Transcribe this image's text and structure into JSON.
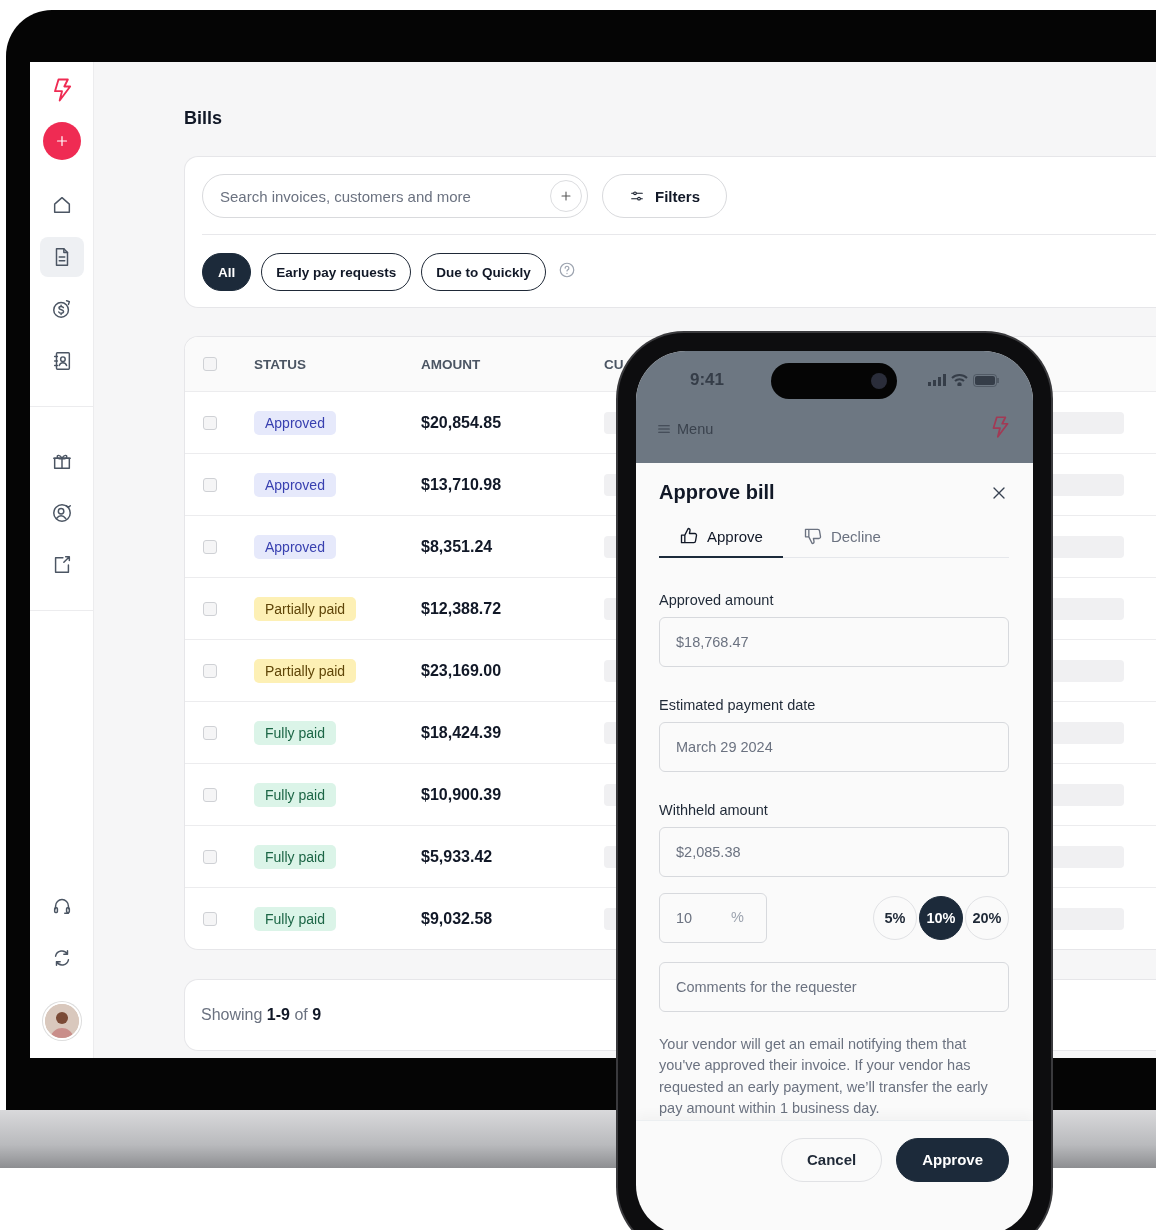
{
  "sidebar": {
    "nav": [
      {
        "selected": false
      },
      {
        "selected": true
      },
      {
        "selected": false
      },
      {
        "selected": false
      }
    ],
    "nav_secondary": [
      {
        "selected": false
      },
      {
        "selected": false
      },
      {
        "selected": false
      }
    ]
  },
  "page": {
    "title": "Bills"
  },
  "search": {
    "placeholder": "Search invoices, customers and more"
  },
  "filters_button": "Filters",
  "chips": [
    {
      "label": "All",
      "selected": true
    },
    {
      "label": "Early pay requests",
      "selected": false
    },
    {
      "label": "Due to Quickly",
      "selected": false
    }
  ],
  "table": {
    "select_all_checked": false,
    "columns": [
      "STATUS",
      "AMOUNT",
      "CU"
    ],
    "rows": [
      {
        "status": "Approved",
        "kind": "approved",
        "amount": "$20,854.85",
        "checked": false
      },
      {
        "status": "Approved",
        "kind": "approved",
        "amount": "$13,710.98",
        "checked": false
      },
      {
        "status": "Approved",
        "kind": "approved",
        "amount": "$8,351.24",
        "checked": false
      },
      {
        "status": "Partially paid",
        "kind": "partial",
        "amount": "$12,388.72",
        "checked": false
      },
      {
        "status": "Partially paid",
        "kind": "partial",
        "amount": "$23,169.00",
        "checked": false
      },
      {
        "status": "Fully paid",
        "kind": "paid",
        "amount": "$18,424.39",
        "checked": false
      },
      {
        "status": "Fully paid",
        "kind": "paid",
        "amount": "$10,900.39",
        "checked": false
      },
      {
        "status": "Fully paid",
        "kind": "paid",
        "amount": "$5,933.42",
        "checked": false
      },
      {
        "status": "Fully paid",
        "kind": "paid",
        "amount": "$9,032.58",
        "checked": false
      }
    ]
  },
  "pagination": "Showing **1-9** of **9**",
  "phone": {
    "time": "9:41",
    "menu_label": "Menu",
    "sheet": {
      "title": "Approve bill",
      "tabs": [
        {
          "label": "Approve",
          "selected": true
        },
        {
          "label": "Decline",
          "selected": false
        }
      ],
      "fields": [
        {
          "label": "Approved amount",
          "value": "$18,768.47"
        },
        {
          "label": "Estimated payment date",
          "value": "March 29 2024"
        },
        {
          "label": "Withheld amount",
          "value": "$2,085.38"
        }
      ],
      "percent": {
        "value": "10",
        "unit": "%"
      },
      "percent_options": [
        {
          "label": "5%",
          "selected": false
        },
        {
          "label": "10%",
          "selected": true
        },
        {
          "label": "20%",
          "selected": false
        }
      ],
      "comments": {
        "placeholder": "Comments for the requester"
      },
      "note": "Your vendor will get an email notifying them that you've approved their invoice. If your vendor has requested an early payment, we’ll transfer the early pay amount within 1 business day.",
      "buttons": [
        {
          "label": "Cancel",
          "kind": "secondary"
        },
        {
          "label": "Approve",
          "kind": "primary"
        }
      ]
    }
  }
}
